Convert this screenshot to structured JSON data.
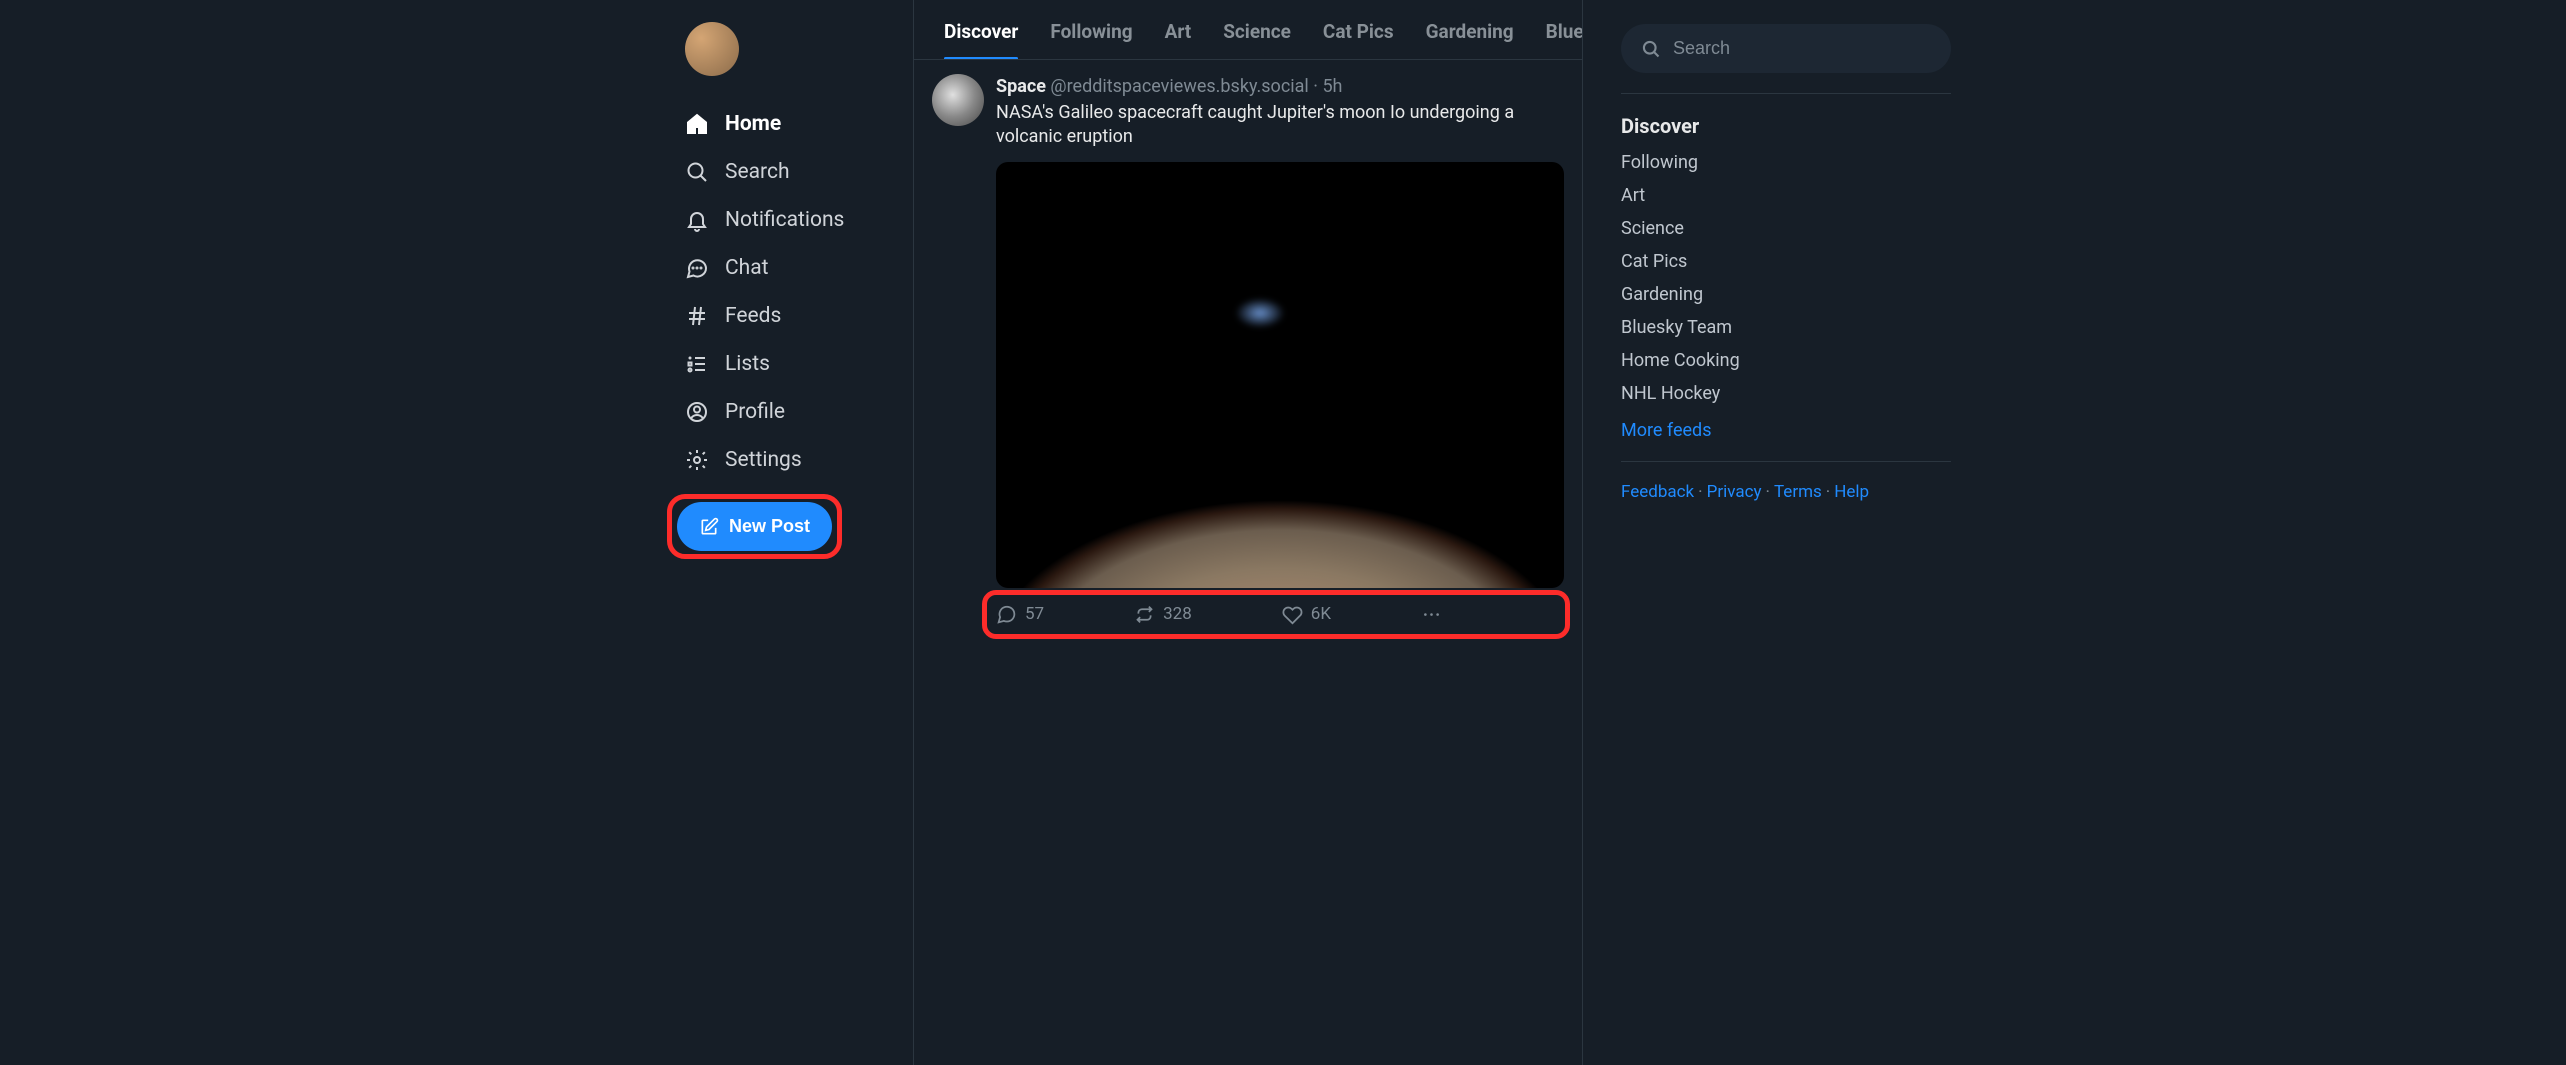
{
  "sidebar": {
    "items": [
      {
        "label": "Home",
        "icon": "home-icon",
        "active": true
      },
      {
        "label": "Search",
        "icon": "search-icon",
        "active": false
      },
      {
        "label": "Notifications",
        "icon": "bell-icon",
        "active": false
      },
      {
        "label": "Chat",
        "icon": "chat-icon",
        "active": false
      },
      {
        "label": "Feeds",
        "icon": "hash-icon",
        "active": false
      },
      {
        "label": "Lists",
        "icon": "lists-icon",
        "active": false
      },
      {
        "label": "Profile",
        "icon": "profile-icon",
        "active": false
      },
      {
        "label": "Settings",
        "icon": "settings-icon",
        "active": false
      }
    ],
    "new_post_label": "New Post"
  },
  "tabs": [
    {
      "label": "Discover",
      "active": true
    },
    {
      "label": "Following",
      "active": false
    },
    {
      "label": "Art",
      "active": false
    },
    {
      "label": "Science",
      "active": false
    },
    {
      "label": "Cat Pics",
      "active": false
    },
    {
      "label": "Gardening",
      "active": false
    },
    {
      "label": "Bluesk",
      "active": false
    }
  ],
  "post": {
    "author_name": "Space",
    "author_handle": "@redditspaceviewes.bsky.social",
    "separator": " · ",
    "time": "5h",
    "text": "NASA's Galileo spacecraft caught Jupiter's moon Io undergoing a volcanic eruption",
    "actions": {
      "reply_count": "57",
      "repost_count": "328",
      "like_count": "6K"
    }
  },
  "search": {
    "placeholder": "Search"
  },
  "right": {
    "heading": "Discover",
    "feeds": [
      "Following",
      "Art",
      "Science",
      "Cat Pics",
      "Gardening",
      "Bluesky Team",
      "Home Cooking",
      "NHL Hockey"
    ],
    "more_label": "More feeds"
  },
  "footer": {
    "links": [
      "Feedback",
      "Privacy",
      "Terms",
      "Help"
    ]
  }
}
